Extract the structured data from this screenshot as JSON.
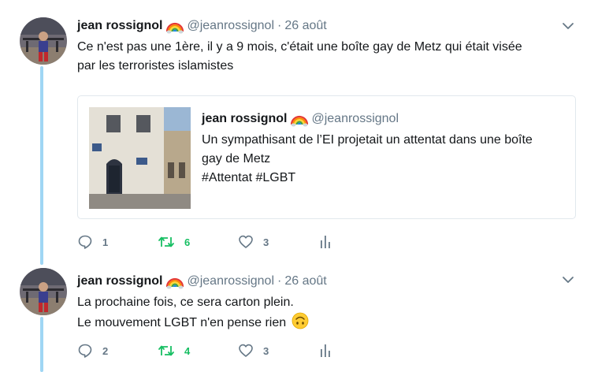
{
  "colors": {
    "text": "#14171a",
    "secondary": "#657786",
    "retweet_green": "#17bf63",
    "thread_line": "#9fd6f4",
    "border": "#e1e8ed"
  },
  "tweets": [
    {
      "author_name": "jean rossignol",
      "handle": "@jeanrossignol",
      "separator": "·",
      "date": "26 août",
      "text_lines": [
        "Ce n'est pas une 1ère, il y a 9 mois, c'était une boîte gay de Metz qui était visée",
        "par les terroristes islamistes"
      ],
      "quote": {
        "author_name": "jean rossignol",
        "handle": "@jeanrossignol",
        "text_lines": [
          "Un sympathisant de l’EI projetait un attentat dans une boîte",
          "gay de Metz"
        ],
        "hashtags": "#Attentat #LGBT"
      },
      "actions": {
        "replies": "1",
        "retweets": "6",
        "likes": "3"
      }
    },
    {
      "author_name": "jean rossignol",
      "handle": "@jeanrossignol",
      "separator": "·",
      "date": "26 août",
      "text_lines": [
        "La prochaine fois, ce sera carton plein.",
        "Le mouvement LGBT n'en pense rien"
      ],
      "actions": {
        "replies": "2",
        "retweets": "4",
        "likes": "3"
      }
    }
  ],
  "icons": {
    "rainbow": "rainbow-emoji-icon",
    "more": "chevron-down-icon",
    "reply": "reply-icon",
    "retweet": "retweet-icon",
    "like": "heart-icon",
    "analytics": "analytics-icon",
    "upside_down": "upside-down-face-emoji-icon"
  }
}
